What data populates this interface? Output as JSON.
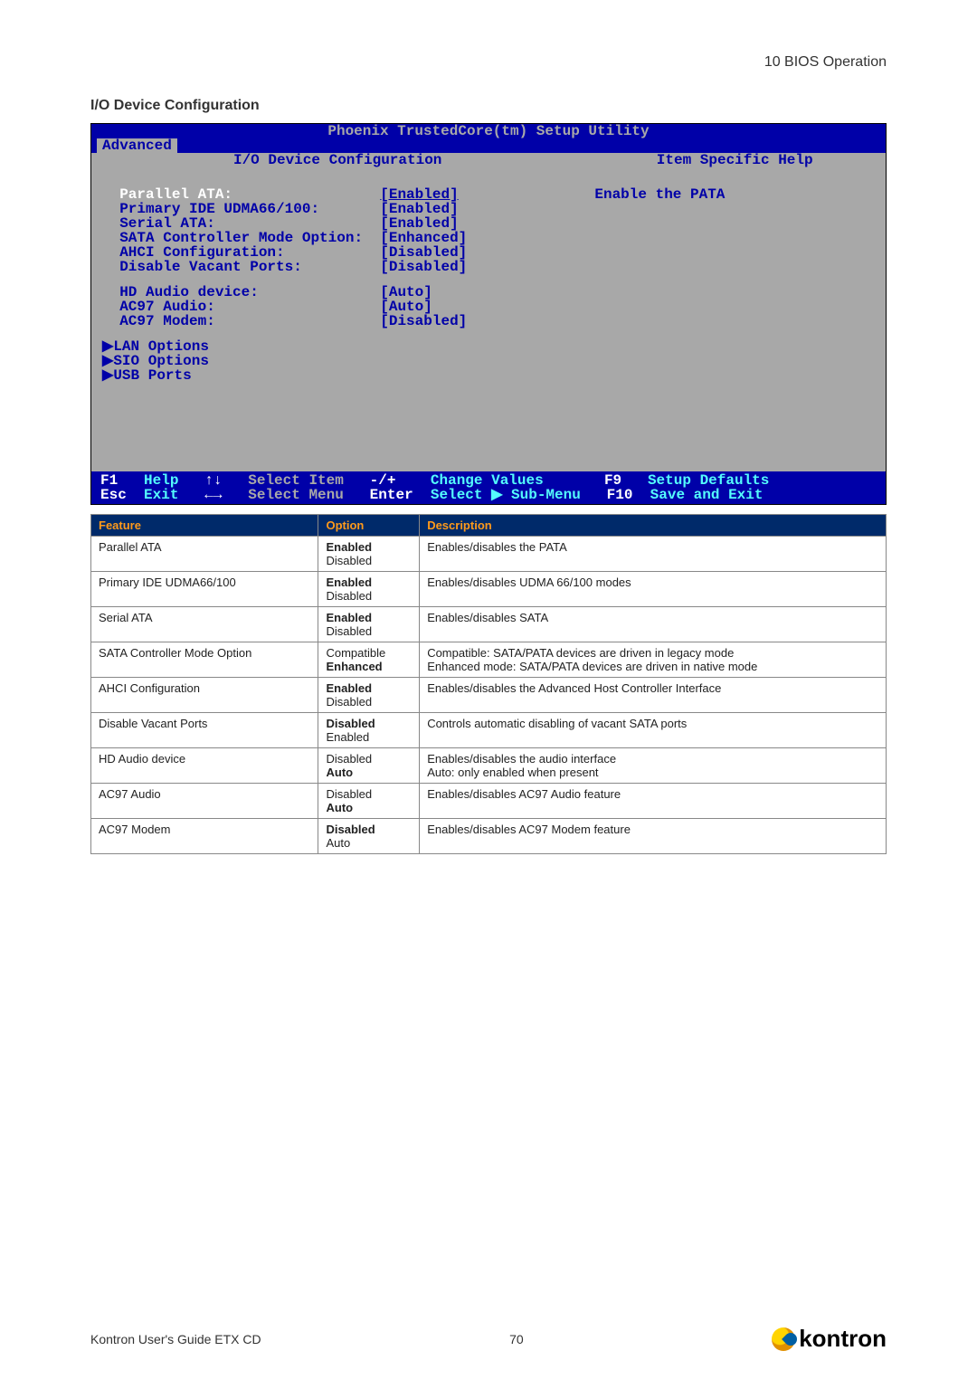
{
  "header": {
    "right": "10 BIOS Operation"
  },
  "section_title": "I/O Device Configuration",
  "bios": {
    "title": "Phoenix TrustedCore(tm) Setup Utility",
    "tab_active": "Advanced",
    "left_title": "I/O Device Configuration",
    "right_title": "Item Specific Help",
    "help_text": "Enable the PATA",
    "rows": [
      {
        "label": "Parallel ATA:",
        "value": "[Enabled]",
        "selected": true
      },
      {
        "label": "Primary IDE UDMA66/100:",
        "value": "[Enabled]"
      },
      {
        "label": "Serial ATA:",
        "value": "[Enabled]"
      },
      {
        "label": "SATA Controller Mode Option:",
        "value": "[Enhanced]"
      },
      {
        "label": "AHCI Configuration:",
        "value": "[Disabled]"
      },
      {
        "label": "Disable Vacant Ports:",
        "value": "[Disabled]"
      }
    ],
    "rows2": [
      {
        "label": "HD Audio device:",
        "value": "[Auto]"
      },
      {
        "label": "AC97 Audio:",
        "value": "[Auto]"
      },
      {
        "label": "AC97 Modem:",
        "value": "[Disabled]"
      }
    ],
    "submenus": [
      "LAN Options",
      "SIO Options",
      "USB Ports"
    ],
    "footer": {
      "f1": "F1",
      "help": "Help",
      "ud": "↑↓",
      "sel_item": "Select Item",
      "pm": "-/+",
      "chg": "Change Values",
      "f9": "F9",
      "setup_def": "Setup Defaults",
      "esc": "Esc",
      "exit": "Exit",
      "lr": "←→",
      "sel_menu": "Select Menu",
      "enter": "Enter",
      "sel_sub": "Select ▶ Sub-Menu",
      "f10": "F10",
      "save": "Save and Exit"
    }
  },
  "table": {
    "headers": [
      "Feature",
      "Option",
      "Description"
    ],
    "rows": [
      {
        "feature": "Parallel ATA",
        "options": [
          {
            "t": "Enabled",
            "b": true
          },
          {
            "t": "Disabled"
          }
        ],
        "desc": "Enables/disables the PATA"
      },
      {
        "feature": "Primary IDE UDMA66/100",
        "options": [
          {
            "t": "Enabled",
            "b": true
          },
          {
            "t": "Disabled"
          }
        ],
        "desc": "Enables/disables UDMA 66/100 modes"
      },
      {
        "feature": "Serial ATA",
        "options": [
          {
            "t": "Enabled",
            "b": true
          },
          {
            "t": "Disabled"
          }
        ],
        "desc": "Enables/disables SATA"
      },
      {
        "feature": "SATA Controller Mode Option",
        "options": [
          {
            "t": "Compatible"
          },
          {
            "t": "Enhanced",
            "b": true
          }
        ],
        "desc": "Compatible: SATA/PATA devices are driven in legacy mode\nEnhanced mode: SATA/PATA devices are driven in native mode"
      },
      {
        "feature": "AHCI Configuration",
        "options": [
          {
            "t": "Enabled",
            "b": true
          },
          {
            "t": "Disabled"
          }
        ],
        "desc": "Enables/disables the Advanced Host Controller Interface"
      },
      {
        "feature": "Disable Vacant Ports",
        "options": [
          {
            "t": "Disabled",
            "b": true
          },
          {
            "t": "Enabled"
          }
        ],
        "desc": "Controls automatic disabling of vacant SATA ports"
      },
      {
        "feature": "HD Audio device",
        "options": [
          {
            "t": "Disabled"
          },
          {
            "t": "Auto",
            "b": true
          }
        ],
        "desc": "Enables/disables the audio interface\nAuto: only enabled when present"
      },
      {
        "feature": "AC97 Audio",
        "options": [
          {
            "t": "Disabled"
          },
          {
            "t": "Auto",
            "b": true
          }
        ],
        "desc": "Enables/disables AC97 Audio feature"
      },
      {
        "feature": "AC97 Modem",
        "options": [
          {
            "t": "Disabled",
            "b": true
          },
          {
            "t": "Auto"
          }
        ],
        "desc": "Enables/disables AC97 Modem feature"
      }
    ]
  },
  "footer": {
    "left": "Kontron User's Guide ETX CD",
    "page": "70",
    "brand": "kontron"
  }
}
